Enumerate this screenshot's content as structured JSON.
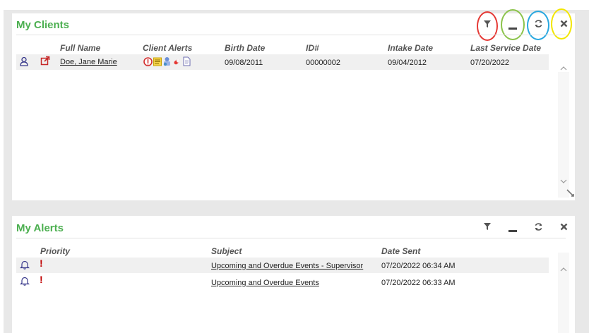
{
  "clients": {
    "title": "My Clients",
    "columns": {
      "full_name": "Full Name",
      "client_alerts": "Client Alerts",
      "birth_date": "Birth Date",
      "id": "ID#",
      "intake_date": "Intake Date",
      "last_service_date": "Last Service Date"
    },
    "rows": [
      {
        "full_name": "Doe, Jane Marie",
        "birth_date": "09/08/2011",
        "id": "00000002",
        "intake_date": "09/04/2012",
        "last_service_date": "07/20/2022"
      }
    ],
    "toolbar": [
      "filter-icon",
      "minimize-icon",
      "refresh-icon",
      "close-icon"
    ],
    "highlight_colors": {
      "filter": "#e53935",
      "minimize": "#8bc34a",
      "refresh": "#29a8e0",
      "close": "#f2e600"
    }
  },
  "alerts": {
    "title": "My Alerts",
    "columns": {
      "priority": "Priority",
      "subject": "Subject",
      "date_sent": "Date Sent"
    },
    "rows": [
      {
        "priority": "!",
        "subject": "Upcoming and Overdue Events - Supervisor",
        "date_sent": "07/20/2022 06:34 AM"
      },
      {
        "priority": "!",
        "subject": "Upcoming and Overdue Events",
        "date_sent": "07/20/2022 06:33 AM"
      }
    ]
  },
  "colors": {
    "title_green": "#4caf50",
    "priority_red": "#c00000",
    "icon_purple": "#3a3a8c",
    "link_red": "#c62828"
  }
}
